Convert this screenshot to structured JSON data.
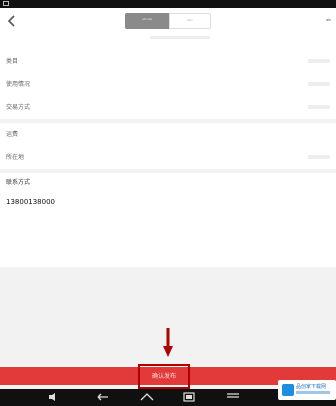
{
  "header": {
    "tabs": [
      {
        "label": "ᵃᵇᶜᵈᵉ",
        "active": true
      },
      {
        "label": "ᵃᵇᶜ",
        "active": false
      }
    ],
    "action_label": "ᵃᵇ"
  },
  "form": {
    "rows_group1": [
      {
        "label": "类目"
      },
      {
        "label": "使用情况"
      },
      {
        "label": "交易方式"
      }
    ],
    "rows_group2": [
      {
        "label": "运费"
      },
      {
        "label": "所在地"
      }
    ],
    "phone_label": "联系方式",
    "phone_value": "13800138000"
  },
  "submit": {
    "label": "确认发布"
  },
  "watermark": {
    "text": "品创家下载网"
  },
  "colors": {
    "accent": "#e23a3a",
    "highlight_box": "#b00000"
  }
}
